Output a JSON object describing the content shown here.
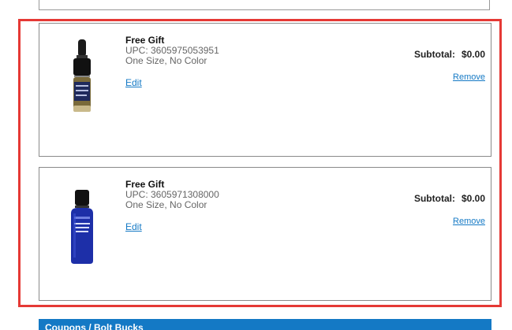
{
  "items": [
    {
      "name": "Free Gift",
      "upc": "UPC: 3605975053951",
      "variant": "One Size, No Color",
      "edit_label": "Edit",
      "subtotal_label": "Subtotal:",
      "subtotal_value": "$0.00",
      "remove_label": "Remove",
      "product_icon": "dropper-bottle-icon"
    },
    {
      "name": "Free Gift",
      "upc": "UPC: 3605971308000",
      "variant": "One Size, No Color",
      "edit_label": "Edit",
      "subtotal_label": "Subtotal:",
      "subtotal_value": "$0.00",
      "remove_label": "Remove",
      "product_icon": "blue-bottle-icon"
    }
  ],
  "coupons_bar": {
    "label": "Coupons / Bolt Bucks"
  },
  "colors": {
    "link": "#1479c5",
    "highlight": "#e53935",
    "bar": "#1479c5"
  }
}
